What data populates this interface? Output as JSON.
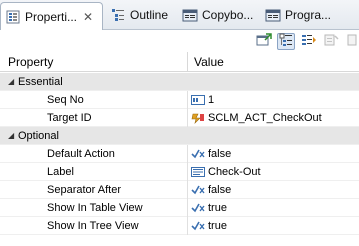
{
  "tabs": [
    {
      "label": "Properti...",
      "icon": "properties-icon",
      "active": true,
      "closable": true
    },
    {
      "label": "Outline",
      "icon": "outline-icon",
      "active": false
    },
    {
      "label": "Copybo...",
      "icon": "copybook-icon",
      "active": false
    },
    {
      "label": "Progra...",
      "icon": "program-icon",
      "active": false
    }
  ],
  "toolbar": [
    {
      "name": "pin-icon",
      "pressed": false
    },
    {
      "name": "show-categories-icon",
      "pressed": true
    },
    {
      "name": "show-advanced-icon",
      "pressed": false
    },
    {
      "name": "restore-default-icon",
      "pressed": false
    }
  ],
  "table": {
    "col_property": "Property",
    "col_value": "Value"
  },
  "categories": [
    {
      "label": "Essential",
      "rows": [
        {
          "property": "Seq No",
          "value": "1",
          "value_icon": "number-icon"
        },
        {
          "property": "Target ID",
          "value": "SCLM_ACT_CheckOut",
          "value_icon": "action-link-icon"
        }
      ]
    },
    {
      "label": "Optional",
      "rows": [
        {
          "property": "Default Action",
          "value": "false",
          "value_icon": "boolean-icon"
        },
        {
          "property": "Label",
          "value": "Check-Out",
          "value_icon": "text-icon"
        },
        {
          "property": "Separator After",
          "value": "false",
          "value_icon": "boolean-icon"
        },
        {
          "property": "Show In Table View",
          "value": "true",
          "value_icon": "boolean-icon"
        },
        {
          "property": "Show In Tree View",
          "value": "true",
          "value_icon": "boolean-icon"
        }
      ]
    }
  ]
}
